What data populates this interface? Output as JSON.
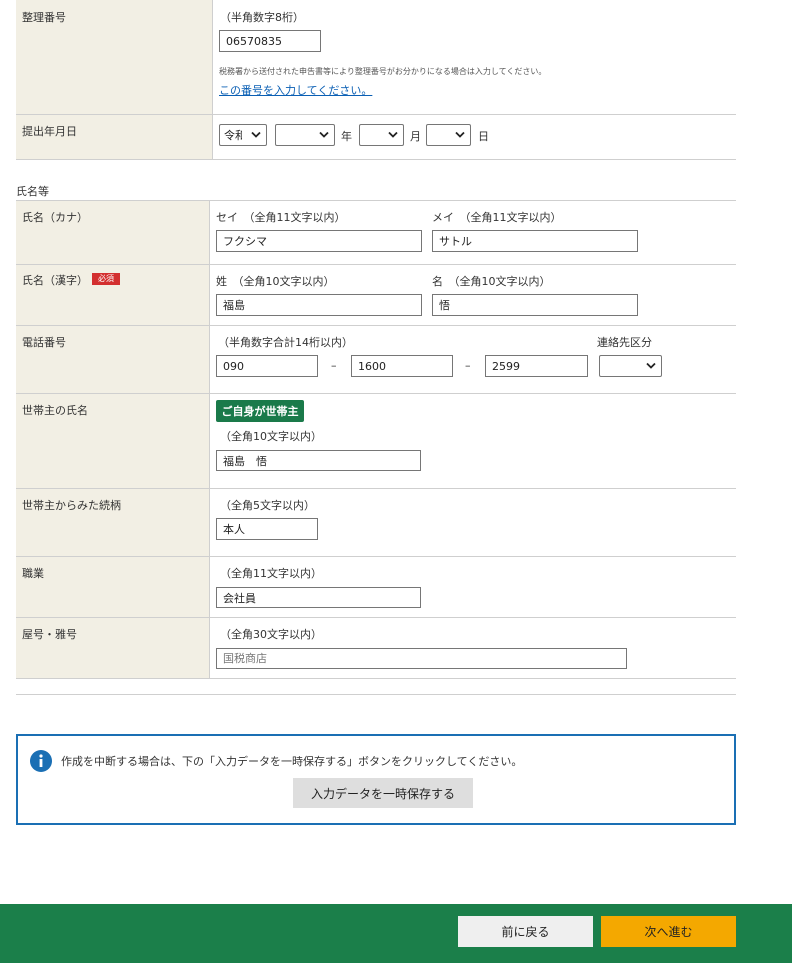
{
  "seiri": {
    "label": "整理番号",
    "hint": "（半角数字8桁）",
    "value": "06570835",
    "note": "税務署から送付された申告書等により整理番号がお分かりになる場合は入力してください。",
    "link": "この番号を入力してください。"
  },
  "teishutsu": {
    "label": "提出年月日",
    "era": "令和",
    "year_unit": "年",
    "month_unit": "月",
    "day_unit": "日"
  },
  "section_title": "氏名等",
  "kana": {
    "label": "氏名（カナ）",
    "sei_hint": "セイ　（全角11文字以内）",
    "mei_hint": "メイ　（全角11文字以内）",
    "sei": "フクシマ",
    "mei": "サトル"
  },
  "kanji": {
    "label": "氏名（漢字）",
    "required": "必須",
    "sei_hint": "姓　（全角10文字以内）",
    "mei_hint": "名　（全角10文字以内）",
    "sei": "福島",
    "mei": "悟"
  },
  "phone": {
    "label": "電話番号",
    "hint": "（半角数字合計14桁以内）",
    "contact_label": "連絡先区分",
    "dash": "–",
    "p1": "090",
    "p2": "1600",
    "p3": "2599"
  },
  "setainushi": {
    "label": "世帯主の氏名",
    "button": "ご自身が世帯主",
    "hint": "（全角10文字以内）",
    "value": "福島　悟"
  },
  "zokugara": {
    "label": "世帯主からみた続柄",
    "hint": "（全角5文字以内）",
    "value": "本人"
  },
  "shokugyo": {
    "label": "職業",
    "hint": "（全角11文字以内）",
    "value": "会社員"
  },
  "yago": {
    "label": "屋号・雅号",
    "hint": "（全角30文字以内）",
    "placeholder": "国税商店"
  },
  "info": {
    "message": "作成を中断する場合は、下の「入力データを一時保存する」ボタンをクリックしてください。",
    "save_button": "入力データを一時保存する"
  },
  "footer": {
    "back": "前に戻る",
    "next": "次へ進む"
  },
  "colors": {
    "label_bg": "#f2efe4",
    "brand_green": "#1b7f4a",
    "required_red": "#d32f2f",
    "next_orange": "#f4a800",
    "info_blue": "#1a6fb4"
  }
}
